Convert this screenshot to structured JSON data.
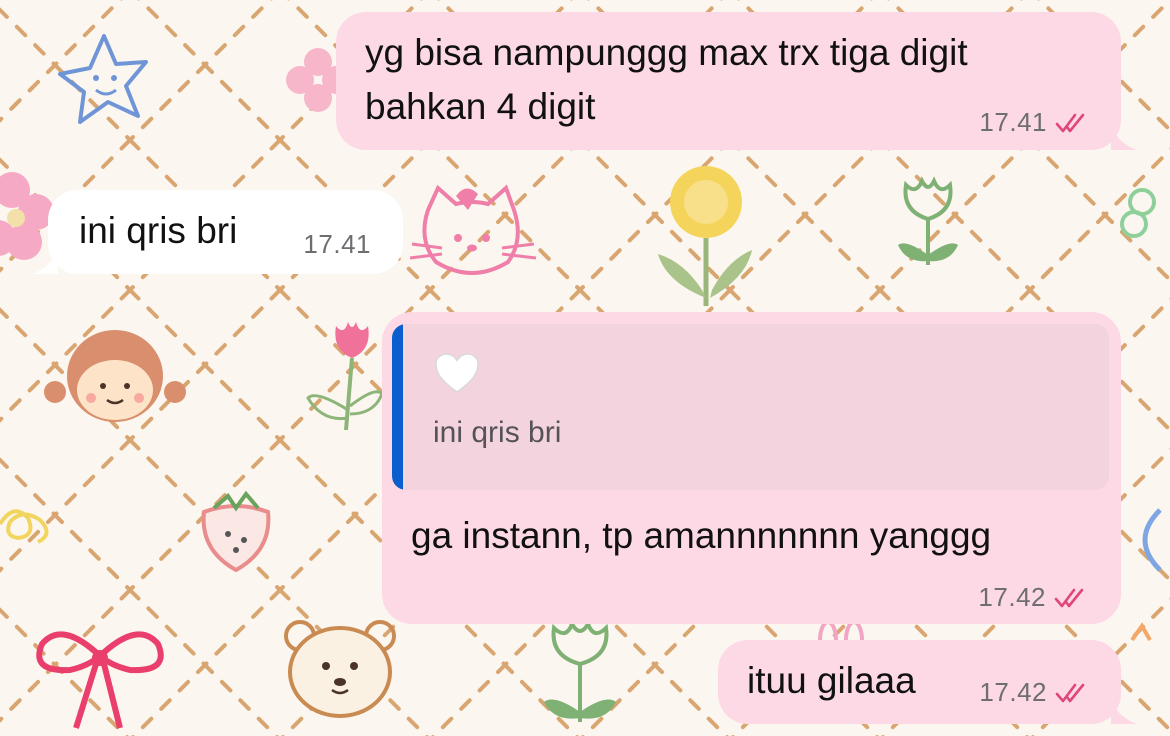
{
  "chat": {
    "messages": [
      {
        "direction": "outgoing",
        "lines": [
          "yg bisa nampunggg max trx tiga digit",
          "bahkan 4 digit"
        ],
        "time": "17.41",
        "status": "read"
      },
      {
        "direction": "incoming",
        "text": "ini qris bri",
        "time": "17.41"
      },
      {
        "direction": "outgoing",
        "reply_to": {
          "emoji": "🤍",
          "text": "ini qris bri"
        },
        "text": "ga instann, tp amannnnnnn yanggg",
        "time": "17.42",
        "status": "read"
      },
      {
        "direction": "outgoing",
        "text": "ituu gilaaa",
        "time": "17.42",
        "status": "read"
      }
    ]
  },
  "theme": {
    "outgoing_bubble": "#fcd9e4",
    "incoming_bubble": "#ffffff",
    "quote_background": "#f3d3dd",
    "quote_accent": "#0b5fcc",
    "read_check": "#e0457b",
    "wallpaper_background": "#fbf7f0"
  },
  "icons": {
    "read_status": "double-check-icon",
    "reply_emoji": "white-heart-icon"
  }
}
